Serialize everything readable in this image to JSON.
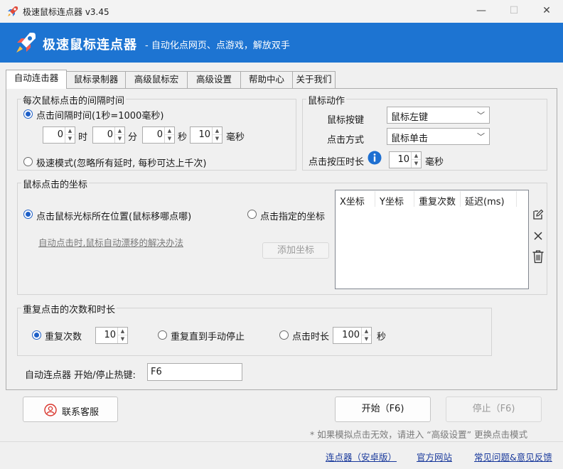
{
  "window": {
    "title": "极速鼠标连点器 v3.45",
    "minimize": "—",
    "maximize": "☐",
    "close": "✕"
  },
  "banner": {
    "title": "极速鼠标连点器",
    "subtitle": "- 自动化点网页、点游戏，解放双手",
    "color": "#1d74d2"
  },
  "tabs": [
    "自动连击器",
    "鼠标录制器",
    "高级鼠标宏",
    "高级设置",
    "帮助中心",
    "关于我们"
  ],
  "interval": {
    "title": "每次鼠标点击的间隔时间",
    "option_interval": "点击间隔时间(1秒=1000毫秒)",
    "hours": "0",
    "hours_unit": "时",
    "minutes": "0",
    "minutes_unit": "分",
    "seconds": "0",
    "seconds_unit": "秒",
    "ms": "10",
    "ms_unit": "毫秒",
    "option_fast": "极速模式(忽略所有延时, 每秒可达上千次)"
  },
  "action": {
    "title": "鼠标动作",
    "button_label": "鼠标按键",
    "button_value": "鼠标左键",
    "mode_label": "点击方式",
    "mode_value": "鼠标单击",
    "press_label": "点击按压时长",
    "press_value": "10",
    "press_unit": "毫秒"
  },
  "coords": {
    "title": "鼠标点击的坐标",
    "option_cursor": "点击鼠标光标所在位置(鼠标移哪点哪)",
    "option_fixed": "点击指定的坐标",
    "drift_link": "自动点击时,鼠标自动漂移的解决办法",
    "add_button": "添加坐标",
    "columns": [
      "X坐标",
      "Y坐标",
      "重复次数",
      "延迟(ms)"
    ]
  },
  "repeat": {
    "title": "重复点击的次数和时长",
    "option_count": "重复次数",
    "count_value": "10",
    "option_manual": "重复直到手动停止",
    "option_duration": "点击时长",
    "duration_value": "100",
    "duration_unit": "秒"
  },
  "hotkey": {
    "label": "自动连点器 开始/停止热键:",
    "value": "F6"
  },
  "footer": {
    "contact_button": "联系客服",
    "start_button": "开始（F6)",
    "stop_button": "停止（F6)",
    "note": "* 如果模拟点击无效，请进入 “高级设置” 更换点击模式",
    "links": [
      "连点器（安卓版）",
      "官方网站",
      "常见问题&意见反馈"
    ]
  },
  "colors": {
    "accent": "#1d5fc7",
    "contact_icon": "#d9342b",
    "info_icon": "#1d6fd1"
  }
}
